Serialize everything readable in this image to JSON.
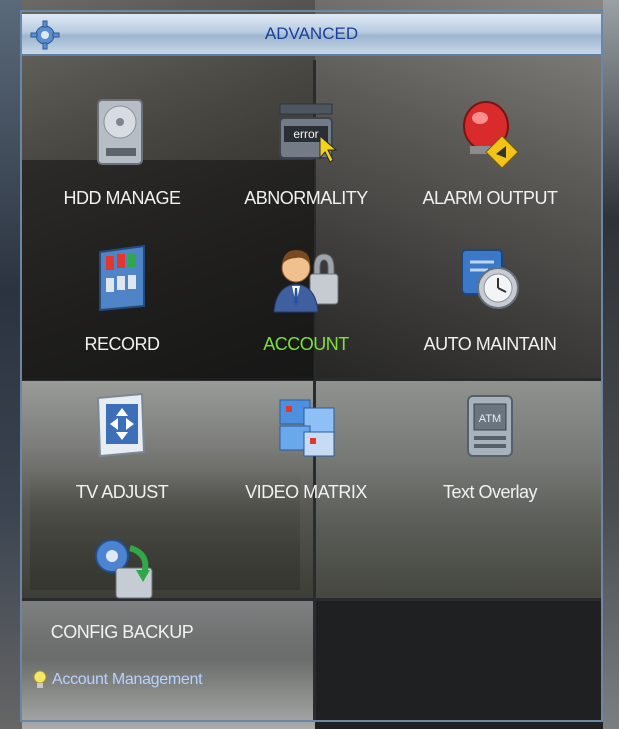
{
  "window": {
    "title": "ADVANCED"
  },
  "menu": {
    "items": [
      {
        "label": "HDD MANAGE",
        "icon": "hdd-icon"
      },
      {
        "label": "ABNORMALITY",
        "icon": "error-icon"
      },
      {
        "label": "ALARM OUTPUT",
        "icon": "alarm-icon"
      },
      {
        "label": "RECORD",
        "icon": "record-icon"
      },
      {
        "label": "ACCOUNT",
        "icon": "account-icon",
        "selected": true
      },
      {
        "label": "AUTO MAINTAIN",
        "icon": "auto-maintain-icon"
      },
      {
        "label": "TV ADJUST",
        "icon": "tv-adjust-icon"
      },
      {
        "label": "VIDEO MATRIX",
        "icon": "video-matrix-icon"
      },
      {
        "label": "Text Overlay",
        "icon": "text-overlay-icon"
      },
      {
        "label": "CONFIG BACKUP",
        "icon": "config-backup-icon"
      }
    ],
    "error_badge_text": "error",
    "atm_badge_text": "ATM"
  },
  "status_bar": {
    "text": "Account Management"
  },
  "colors": {
    "title_text": "#1a3f9a",
    "label": "#f1f1f1",
    "selected_label": "#7de03a",
    "status_text": "#b8d2ff"
  }
}
